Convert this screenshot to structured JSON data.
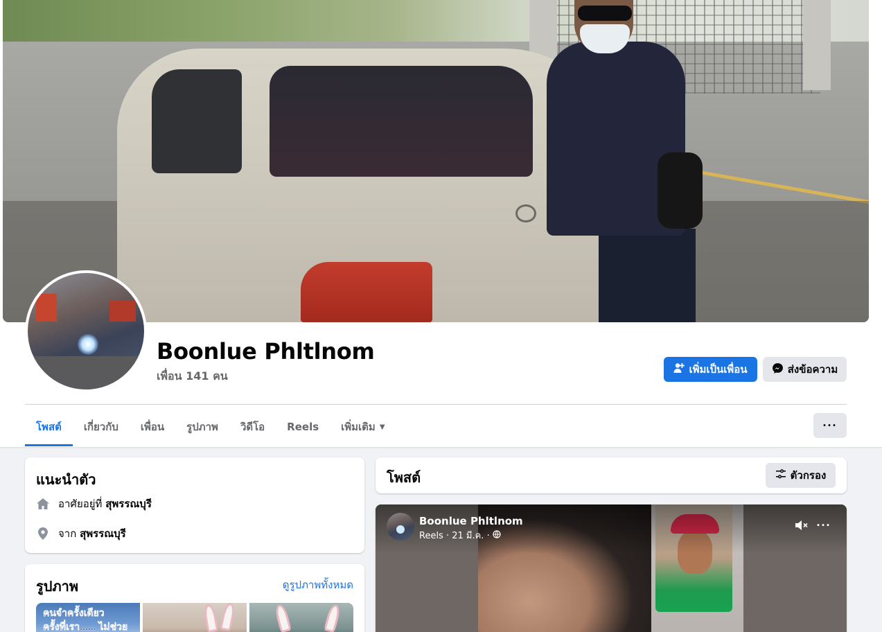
{
  "profile": {
    "name": "Boonlue Phltlnom",
    "friends": "เพื่อน 141 คน"
  },
  "actions": {
    "add_friend": "เพิ่มเป็นเพื่อน",
    "message": "ส่งข้อความ"
  },
  "tabs": [
    {
      "label": "โพสต์",
      "active": true
    },
    {
      "label": "เกี่ยวกับ"
    },
    {
      "label": "เพื่อน"
    },
    {
      "label": "รูปภาพ"
    },
    {
      "label": "วิดีโอ"
    },
    {
      "label": "Reels"
    },
    {
      "label": "เพิ่มเติม"
    }
  ],
  "more_button": "···",
  "intro": {
    "title": "แนะนำตัว",
    "lives_prefix": "อาศัยอยู่ที่",
    "lives_place": "สุพรรณบุรี",
    "from_prefix": "จาก",
    "from_place": "สุพรรณบุรี"
  },
  "photos": {
    "title": "รูปภาพ",
    "see_all": "ดูรูปภาพทั้งหมด",
    "thumb1_text_line1": "คนจำครั้งเดียว",
    "thumb1_text_line2": "ครั้งที่เรา...... ไม่ช่วย"
  },
  "posts": {
    "title": "โพสต์",
    "filter": "ตัวกรอง"
  },
  "post": {
    "author": "Boonlue Phltlnom",
    "meta": "Reels · 21 มี.ค. ·",
    "more": "···"
  },
  "colors": {
    "primary": "#1b74e4",
    "background": "#f0f2f5",
    "secondary_button": "#e4e6eb",
    "muted_text": "#65676b"
  }
}
